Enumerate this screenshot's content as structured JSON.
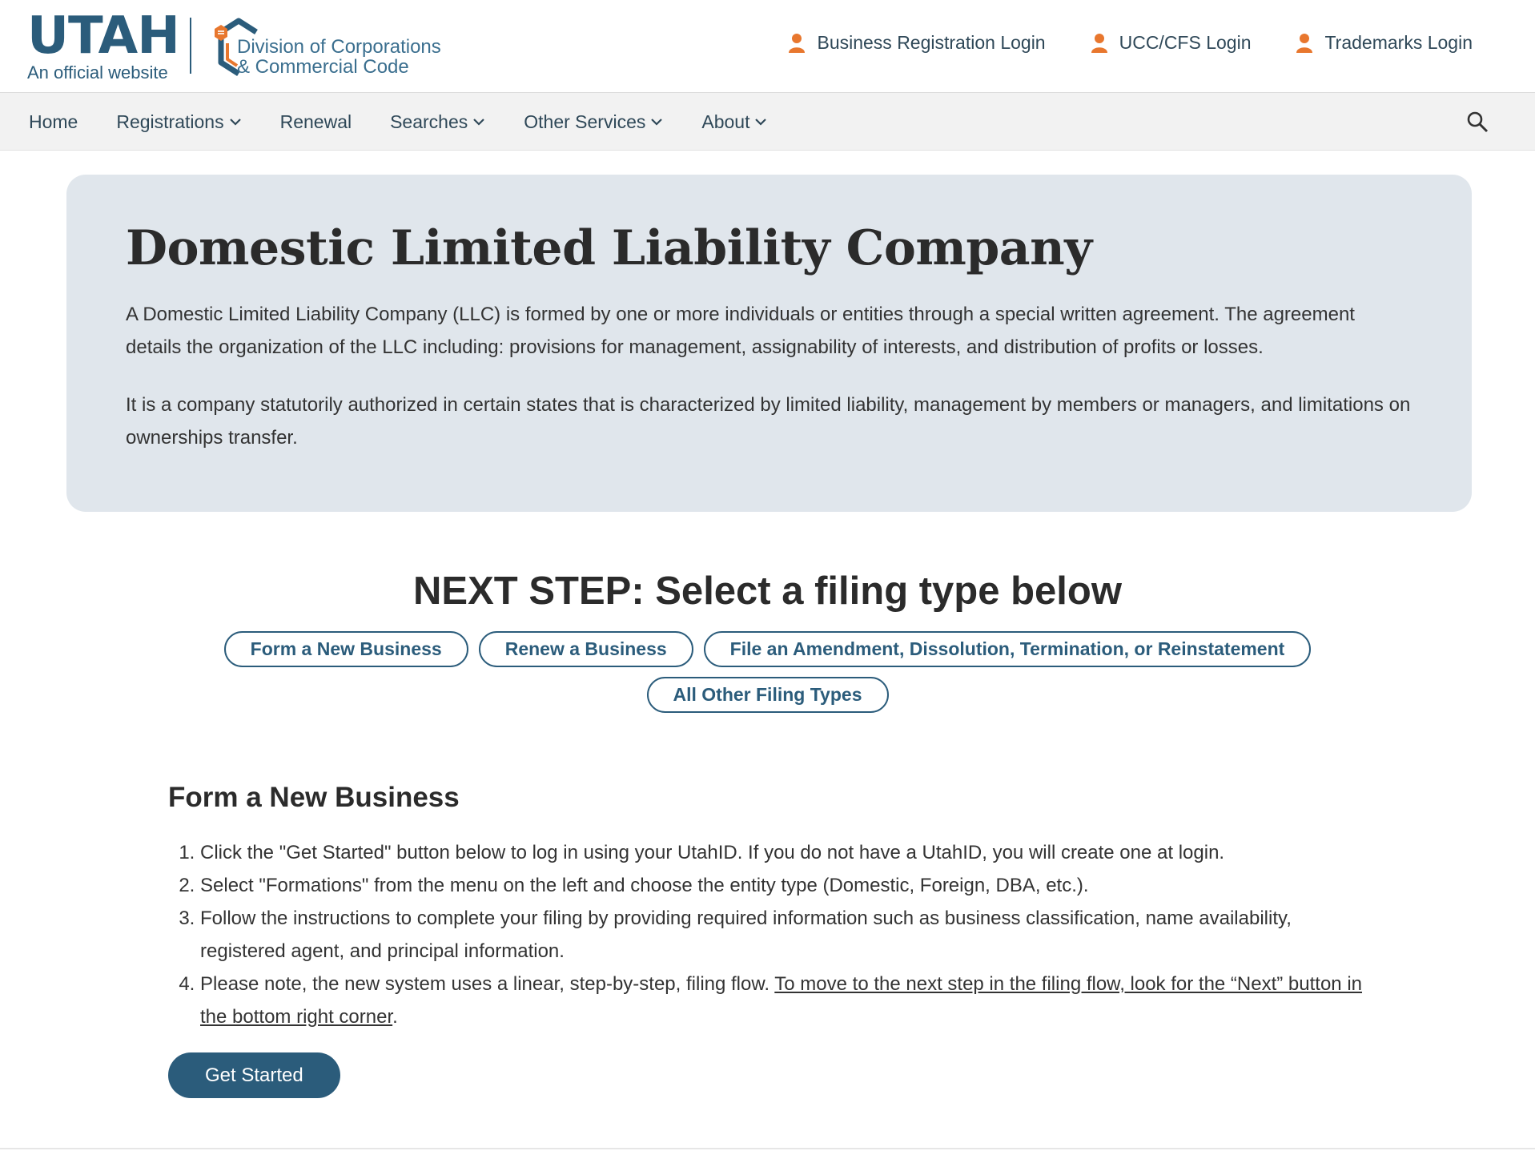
{
  "header": {
    "utah_word": "UTAH",
    "utah_tagline": "An official website",
    "division_line1": "Division of Corporations",
    "division_line2": "& Commercial Code",
    "logins": [
      {
        "label": "Business Registration Login",
        "icon": "user-icon"
      },
      {
        "label": "UCC/CFS Login",
        "icon": "user-icon"
      },
      {
        "label": "Trademarks Login",
        "icon": "user-icon"
      }
    ]
  },
  "nav": {
    "items": [
      {
        "label": "Home",
        "dropdown": false
      },
      {
        "label": "Registrations",
        "dropdown": true
      },
      {
        "label": "Renewal",
        "dropdown": false
      },
      {
        "label": "Searches",
        "dropdown": true
      },
      {
        "label": "Other Services",
        "dropdown": true
      },
      {
        "label": "About",
        "dropdown": true
      }
    ],
    "search_icon": "search-icon"
  },
  "hero": {
    "title": "Domestic Limited Liability Company",
    "paragraph1": "A Domestic Limited Liability Company (LLC) is formed by one or more individuals or entities through a special written agreement. The agreement details the organization of the LLC including: provisions for management, assignability of interests, and distribution of profits or losses.",
    "paragraph2": "It is a company statutorily authorized in certain states that is characterized by limited liability, management by members or managers, and limitations on ownerships transfer."
  },
  "next_step": {
    "title": "NEXT STEP: Select a filing type below",
    "buttons": [
      "Form a New Business",
      "Renew a Business",
      "File an Amendment, Dissolution, Termination, or Reinstatement",
      "All Other Filing Types"
    ]
  },
  "form_section": {
    "title": "Form a New Business",
    "steps": [
      "Click the \"Get Started\" button below to log in using your UtahID. If you do not have a UtahID, you will create one at login.",
      "Select \"Formations\" from the menu on the left and choose the entity type (Domestic, Foreign, DBA, etc.).",
      "Follow the instructions to complete your filing by providing required information such as business classification, name availability, registered agent, and principal information."
    ],
    "step4_text": "Please note, the new system uses a linear, step-by-step, filing flow. ",
    "step4_link": "To move to the next step in the filing flow, look for the “Next” button in the bottom right corner",
    "step4_end": ".",
    "get_started_label": "Get Started"
  },
  "colors": {
    "brand_blue": "#2b5c7b",
    "accent_orange": "#e8772e",
    "hero_bg": "#e0e6ec",
    "nav_bg": "#f2f2f2"
  }
}
